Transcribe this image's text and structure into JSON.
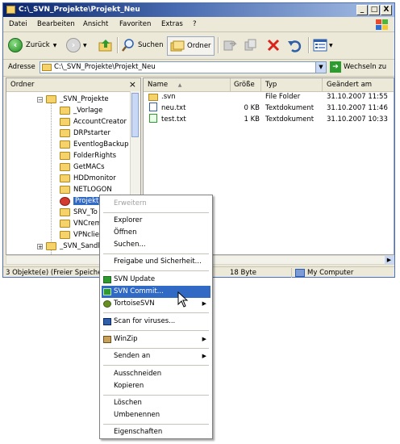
{
  "window": {
    "title": "C:\\_SVN_Projekte\\Projekt_Neu",
    "controls": {
      "minimize": "_",
      "maximize": "□",
      "close": "X"
    }
  },
  "menubar": {
    "items": [
      "Datei",
      "Bearbeiten",
      "Ansicht",
      "Favoriten",
      "Extras",
      "?"
    ]
  },
  "toolbar": {
    "back_label": "Zurück",
    "search_label": "Suchen",
    "folders_label": "Ordner"
  },
  "address": {
    "label": "Adresse",
    "value": "C:\\_SVN_Projekte\\Projekt_Neu",
    "go_label": "Wechseln zu"
  },
  "folder_pane": {
    "title": "Ordner",
    "close": "×",
    "root": "_SVN_Projekte",
    "items": [
      "_Vorlage",
      "AccountCreator",
      "DRPstarter",
      "EventlogBackup",
      "FolderRights",
      "GetMACs",
      "HDDmonitor",
      "NETLOGON",
      "Projekt_Neu",
      "SRV_To",
      "VNCrem",
      "VPNclier"
    ],
    "sibling": "_SVN_Sandl"
  },
  "file_list": {
    "columns": [
      "Name",
      "Größe",
      "Typ",
      "Geändert am"
    ],
    "rows": [
      {
        "name": ".svn",
        "size": "",
        "type": "File Folder",
        "modified": "31.10.2007 11:55"
      },
      {
        "name": "neu.txt",
        "size": "0 KB",
        "type": "Textdokument",
        "modified": "31.10.2007 11:46"
      },
      {
        "name": "test.txt",
        "size": "1 KB",
        "type": "Textdokument",
        "modified": "31.10.2007 10:33"
      }
    ]
  },
  "statusbar": {
    "left": "3 Objekte(e) (Freier Speicher",
    "size": "18 Byte",
    "location": "My Computer"
  },
  "context_menu": {
    "items": [
      {
        "label": "Erweitern",
        "disabled": true
      },
      {
        "label": "Explorer"
      },
      {
        "label": "Öffnen"
      },
      {
        "label": "Suchen..."
      },
      {
        "label": "Freigabe und Sicherheit..."
      },
      {
        "label": "SVN Update"
      },
      {
        "label": "SVN Commit...",
        "highlighted": true
      },
      {
        "label": "TortoiseSVN",
        "submenu": true
      },
      {
        "label": "Scan for viruses..."
      },
      {
        "label": "WinZip",
        "submenu": true
      },
      {
        "label": "Senden an",
        "submenu": true
      },
      {
        "label": "Ausschneiden"
      },
      {
        "label": "Kopieren"
      },
      {
        "label": "Löschen"
      },
      {
        "label": "Umbenennen"
      },
      {
        "label": "Eigenschaften"
      }
    ]
  },
  "colors": {
    "title_gradient_start": "#0a246a",
    "selection": "#316ac5",
    "folder": "#f5d36a"
  }
}
